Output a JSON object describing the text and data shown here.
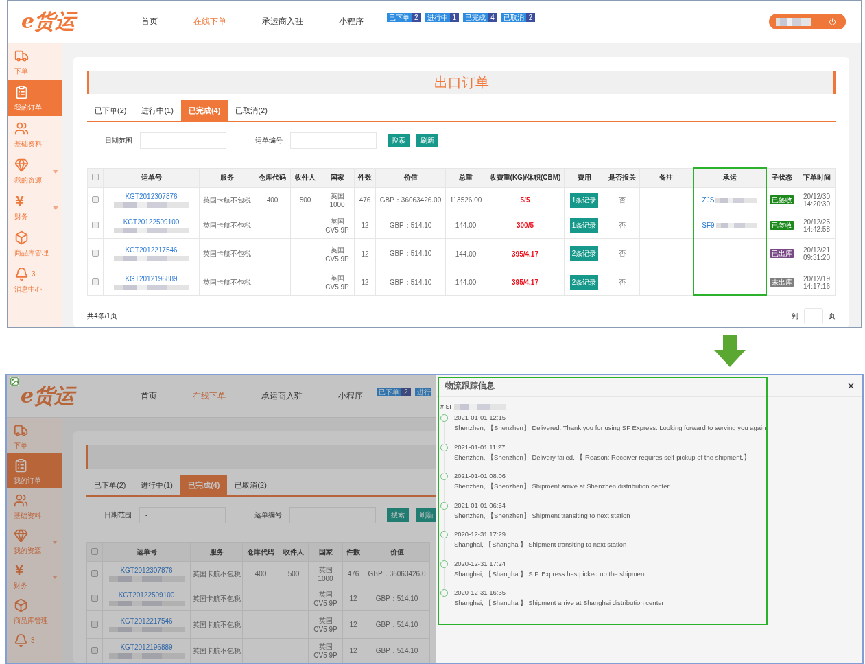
{
  "top_screen": {
    "logo": "e货运",
    "nav": [
      {
        "label": "首页",
        "selected": false
      },
      {
        "label": "在线下单",
        "selected": true
      },
      {
        "label": "承运商入驻",
        "selected": false
      },
      {
        "label": "小程序",
        "selected": false
      }
    ],
    "order_badges": [
      {
        "label": "已下单",
        "count": "2"
      },
      {
        "label": "进行中",
        "count": "1"
      },
      {
        "label": "已完成",
        "count": "4"
      },
      {
        "label": "已取消",
        "count": "2"
      }
    ],
    "sidebar": [
      {
        "label": "下单",
        "selected": false,
        "expandable": false
      },
      {
        "label": "我的订单",
        "selected": true,
        "expandable": false
      },
      {
        "label": "基础资料",
        "selected": false,
        "expandable": false
      },
      {
        "label": "我的资源",
        "selected": false,
        "expandable": true
      },
      {
        "label": "财务",
        "selected": false,
        "expandable": true
      },
      {
        "label": "商品库管理",
        "selected": false,
        "expandable": false
      },
      {
        "label": "消息中心",
        "selected": false,
        "expandable": false,
        "count": "3"
      }
    ],
    "page_title": "出口订单",
    "tabs": [
      {
        "label": "已下单(2)",
        "selected": false
      },
      {
        "label": "进行中(1)",
        "selected": false
      },
      {
        "label": "已完成(4)",
        "selected": true
      },
      {
        "label": "已取消(2)",
        "selected": false
      }
    ],
    "filters": {
      "date_label": "日期范围",
      "date_value": "-",
      "waybill_label": "运单编号"
    },
    "buttons": [
      "搜索",
      "刷新"
    ],
    "table": {
      "all_checked": false,
      "columns": [
        {},
        {
          "label": "运单号",
          "highlighted": false
        },
        {
          "label": "服务",
          "highlighted": false
        },
        {
          "label": "仓库代码",
          "highlighted": false
        },
        {
          "label": "收件人",
          "highlighted": false
        },
        {
          "label": "国家",
          "highlighted": false
        },
        {
          "label": "件数",
          "highlighted": false
        },
        {
          "label": "价值",
          "highlighted": false
        },
        {
          "label": "总重",
          "highlighted": false
        },
        {
          "label": "收费重(KG)/体积(CBM)",
          "highlighted": false
        },
        {
          "label": "费用",
          "highlighted": false
        },
        {
          "label": "是否报关",
          "highlighted": false
        },
        {
          "label": "备注",
          "highlighted": false
        },
        {
          "label": "承运",
          "highlighted": true
        },
        {
          "label": "子状态",
          "highlighted": false
        },
        {
          "label": "下单时间",
          "highlighted": false
        }
      ],
      "rows": [
        {
          "checked": false,
          "waybill": "KGT2012307876",
          "service": "英国卡航不包税",
          "warehouse": "400",
          "recipient": "500",
          "country": "英国",
          "postcode": "1000",
          "pieces": "476",
          "value": "GBP：36063426.00",
          "weight": "113526.00",
          "charge_weight": "5/5",
          "fee": "1条记录",
          "customs": "否",
          "carrier": "ZJS",
          "status": "已签收",
          "color": "#1e8a1e",
          "date": "20/12/30",
          "time": "14:20:30"
        },
        {
          "checked": false,
          "waybill": "KGT20122509100",
          "service": "英国卡航不包税",
          "country": "英国",
          "postcode": "CV5 9P",
          "pieces": "12",
          "value": "GBP：514.10",
          "weight": "144.00",
          "charge_weight": "300/5",
          "fee": "1条记录",
          "customs": "否",
          "carrier": "SF9",
          "status": "已签收",
          "color": "#1e8a1e",
          "date": "20/12/25",
          "time": "14:42:58"
        },
        {
          "checked": false,
          "waybill": "KGT2012217546",
          "service": "英国卡航不包税",
          "country": "英国",
          "postcode": "CV5 9P",
          "pieces": "12",
          "value": "GBP：514.10",
          "weight": "144.00",
          "charge_weight": "395/4.17",
          "fee": "2条记录",
          "customs": "否",
          "status": "已出库",
          "color": "#7a4a86",
          "date": "20/12/21",
          "time": "09:31:20"
        },
        {
          "checked": false,
          "waybill": "KGT2012196889",
          "service": "英国卡航不包税",
          "country": "英国",
          "postcode": "CV5 9P",
          "pieces": "12",
          "value": "GBP：514.10",
          "weight": "144.00",
          "charge_weight": "395/4.17",
          "fee": "2条记录",
          "customs": "否",
          "status": "未出库",
          "color": "#7f7f7f",
          "date": "20/12/19",
          "time": "14:17:16"
        }
      ]
    },
    "footer": {
      "summary": "共4条/1页",
      "goto_label": "到",
      "page_label": "页"
    }
  },
  "bottom_screen": {
    "logo": "e货运",
    "overlay": true,
    "nav": [
      {
        "label": "首页",
        "selected": false
      },
      {
        "label": "在线下单",
        "selected": true
      },
      {
        "label": "承运商入驻",
        "selected": false
      },
      {
        "label": "小程序",
        "selected": false
      }
    ],
    "order_badges": [
      {
        "label": "已下单",
        "count": "2"
      },
      {
        "label": "进行"
      }
    ],
    "sidebar": [
      {
        "label": "下单",
        "selected": false,
        "expandable": false
      },
      {
        "label": "我的订单",
        "selected": true,
        "expandable": false
      },
      {
        "label": "基础资料",
        "selected": false,
        "expandable": false
      },
      {
        "label": "我的资源",
        "selected": false,
        "expandable": true
      },
      {
        "label": "财务",
        "selected": false,
        "expandable": true
      },
      {
        "label": "商品库管理",
        "selected": false,
        "expandable": false
      },
      {
        "selected": false,
        "expandable": false,
        "count": "3"
      }
    ],
    "tabs": [
      {
        "label": "已下单(2)",
        "selected": false
      },
      {
        "label": "进行中(1)",
        "selected": false
      },
      {
        "label": "已完成(4)",
        "selected": true
      },
      {
        "label": "已取消(2)",
        "selected": false
      }
    ],
    "filters": {
      "date_label": "日期范围",
      "date_value": "-",
      "waybill_label": "运单编号"
    },
    "buttons": [
      "搜索",
      "刷新"
    ],
    "table": {
      "all_checked": false,
      "columns": [
        {},
        {
          "label": "运单号",
          "highlighted": false
        },
        {
          "label": "服务",
          "highlighted": false
        },
        {
          "label": "仓库代码",
          "highlighted": false
        },
        {
          "label": "收件人",
          "highlighted": false
        },
        {
          "label": "国家",
          "highlighted": false
        },
        {
          "label": "件数",
          "highlighted": false
        },
        {
          "label": "价值",
          "highlighted": false
        }
      ],
      "rows": [
        {
          "checked": false,
          "waybill": "KGT2012307876",
          "service": "英国卡航不包税",
          "warehouse": "400",
          "recipient": "500",
          "country": "英国",
          "postcode": "1000",
          "pieces": "476",
          "value": "GBP：36063426.0"
        },
        {
          "checked": false,
          "waybill": "KGT20122509100",
          "service": "英国卡航不包税",
          "country": "英国",
          "postcode": "CV5 9P",
          "pieces": "12",
          "value": "GBP：514.10"
        },
        {
          "checked": false,
          "waybill": "KGT2012217546",
          "service": "英国卡航不包税",
          "country": "英国",
          "postcode": "CV5 9P",
          "pieces": "12",
          "value": "GBP：514.10"
        },
        {
          "checked": false,
          "waybill": "KGT2012196889",
          "service": "英国卡航不包税",
          "country": "英国",
          "postcode": "CV5 9P",
          "pieces": "12",
          "value": "GBP：514.10"
        }
      ]
    },
    "tracking_drawer": {
      "title": "物流跟踪信息",
      "tracking_prefix": "# SF",
      "highlighted": true,
      "events": [
        {
          "time": "2021-01-01 12:15",
          "text": "Shenzhen, 【Shenzhen】 Delivered. Thank you for using SF Express. Looking forward to serving you again"
        },
        {
          "time": "2021-01-01 11:27",
          "text": "Shenzhen, 【Shenzhen】 Delivery failed. 【 Reason: Receiver requires self-pickup of the shipment.】"
        },
        {
          "time": "2021-01-01 08:06",
          "text": "Shenzhen, 【Shenzhen】 Shipment arrive at Shenzhen distribution center"
        },
        {
          "time": "2021-01-01 06:54",
          "text": "Shenzhen, 【Shenzhen】 Shipment transiting to next station"
        },
        {
          "time": "2020-12-31 17:29",
          "text": "Shanghai, 【Shanghai】 Shipment transiting to next station"
        },
        {
          "time": "2020-12-31 17:24",
          "text": "Shanghai, 【Shanghai】 S.F. Express has picked up the shipment"
        },
        {
          "time": "2020-12-31 16:35",
          "text": "Shanghai, 【Shanghai】 Shipment arrive at Shanghai distribution center"
        }
      ]
    }
  }
}
